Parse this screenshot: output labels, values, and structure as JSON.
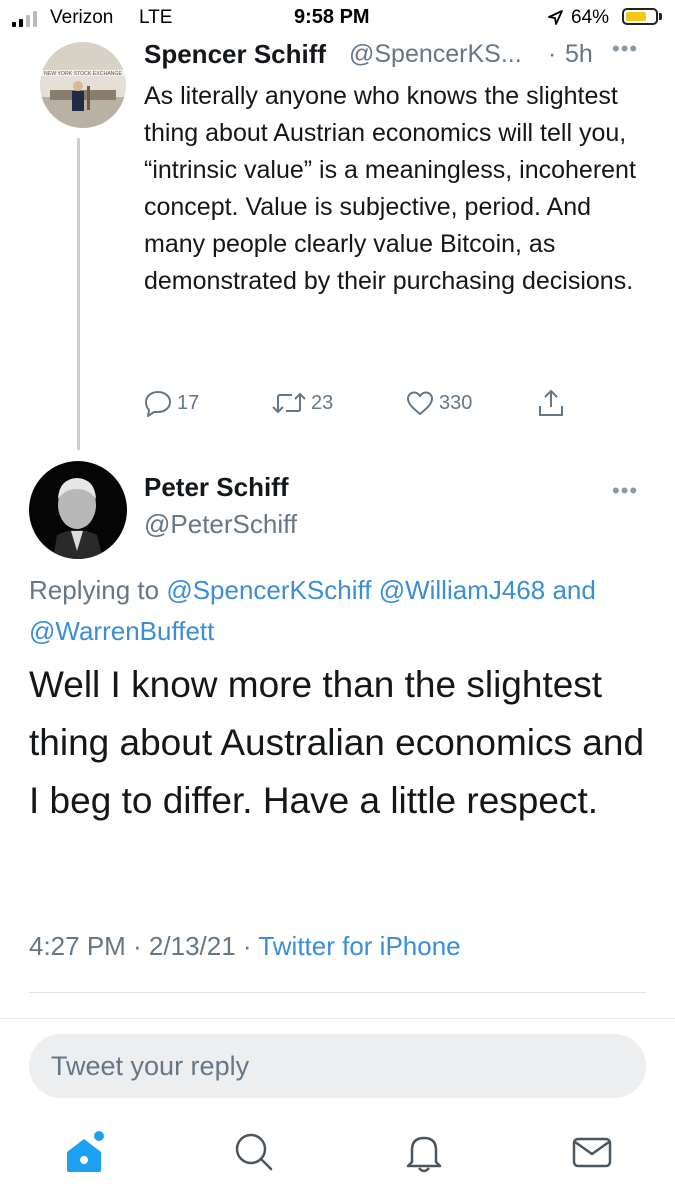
{
  "status_bar": {
    "carrier": "Verizon",
    "network": "LTE",
    "time": "9:58 PM",
    "battery": "64%",
    "battery_level": 0.64,
    "icons": [
      "signal-icon",
      "location-icon",
      "battery-icon"
    ]
  },
  "parent_tweet": {
    "name": "Spencer Schiff",
    "handle": "@SpencerKS...",
    "separator": "·",
    "time": "5h",
    "more": "•••",
    "text": "As literally anyone who knows the slightest thing about Austrian economics will tell you, “intrinsic value” is a meaningless, incoherent concept. Value is subjective, period. And many people clearly value Bitcoin, as demonstrated by their purchasing decisions.",
    "avatar_caption": "NEW YORK STOCK EXCHANGE",
    "replies": "17",
    "retweets": "23",
    "likes": "330"
  },
  "main_tweet": {
    "name": "Peter Schiff",
    "handle": "@PeterSchiff",
    "more": "•••",
    "replying_prefix": "Replying to",
    "reply_to_1": "@SpencerKSchiff",
    "reply_to_2": "@WilliamJ468",
    "reply_and": "and",
    "reply_to_3": "@WarrenBuffett",
    "text": "Well I know more than the slightest thing about Australian economics and I beg to differ. Have a little respect.",
    "timestamp": "4:27 PM · 2/13/21 ·",
    "source": "Twitter for iPhone"
  },
  "reply_box": {
    "placeholder": "Tweet your reply"
  },
  "tab_bar": {
    "items": [
      "home-icon",
      "search-icon",
      "notifications-icon",
      "messages-icon"
    ]
  },
  "colors": {
    "link": "#3b8ed6",
    "secondary": "#657786",
    "primary_text": "#14171a",
    "active_tab": "#1da1f2"
  }
}
